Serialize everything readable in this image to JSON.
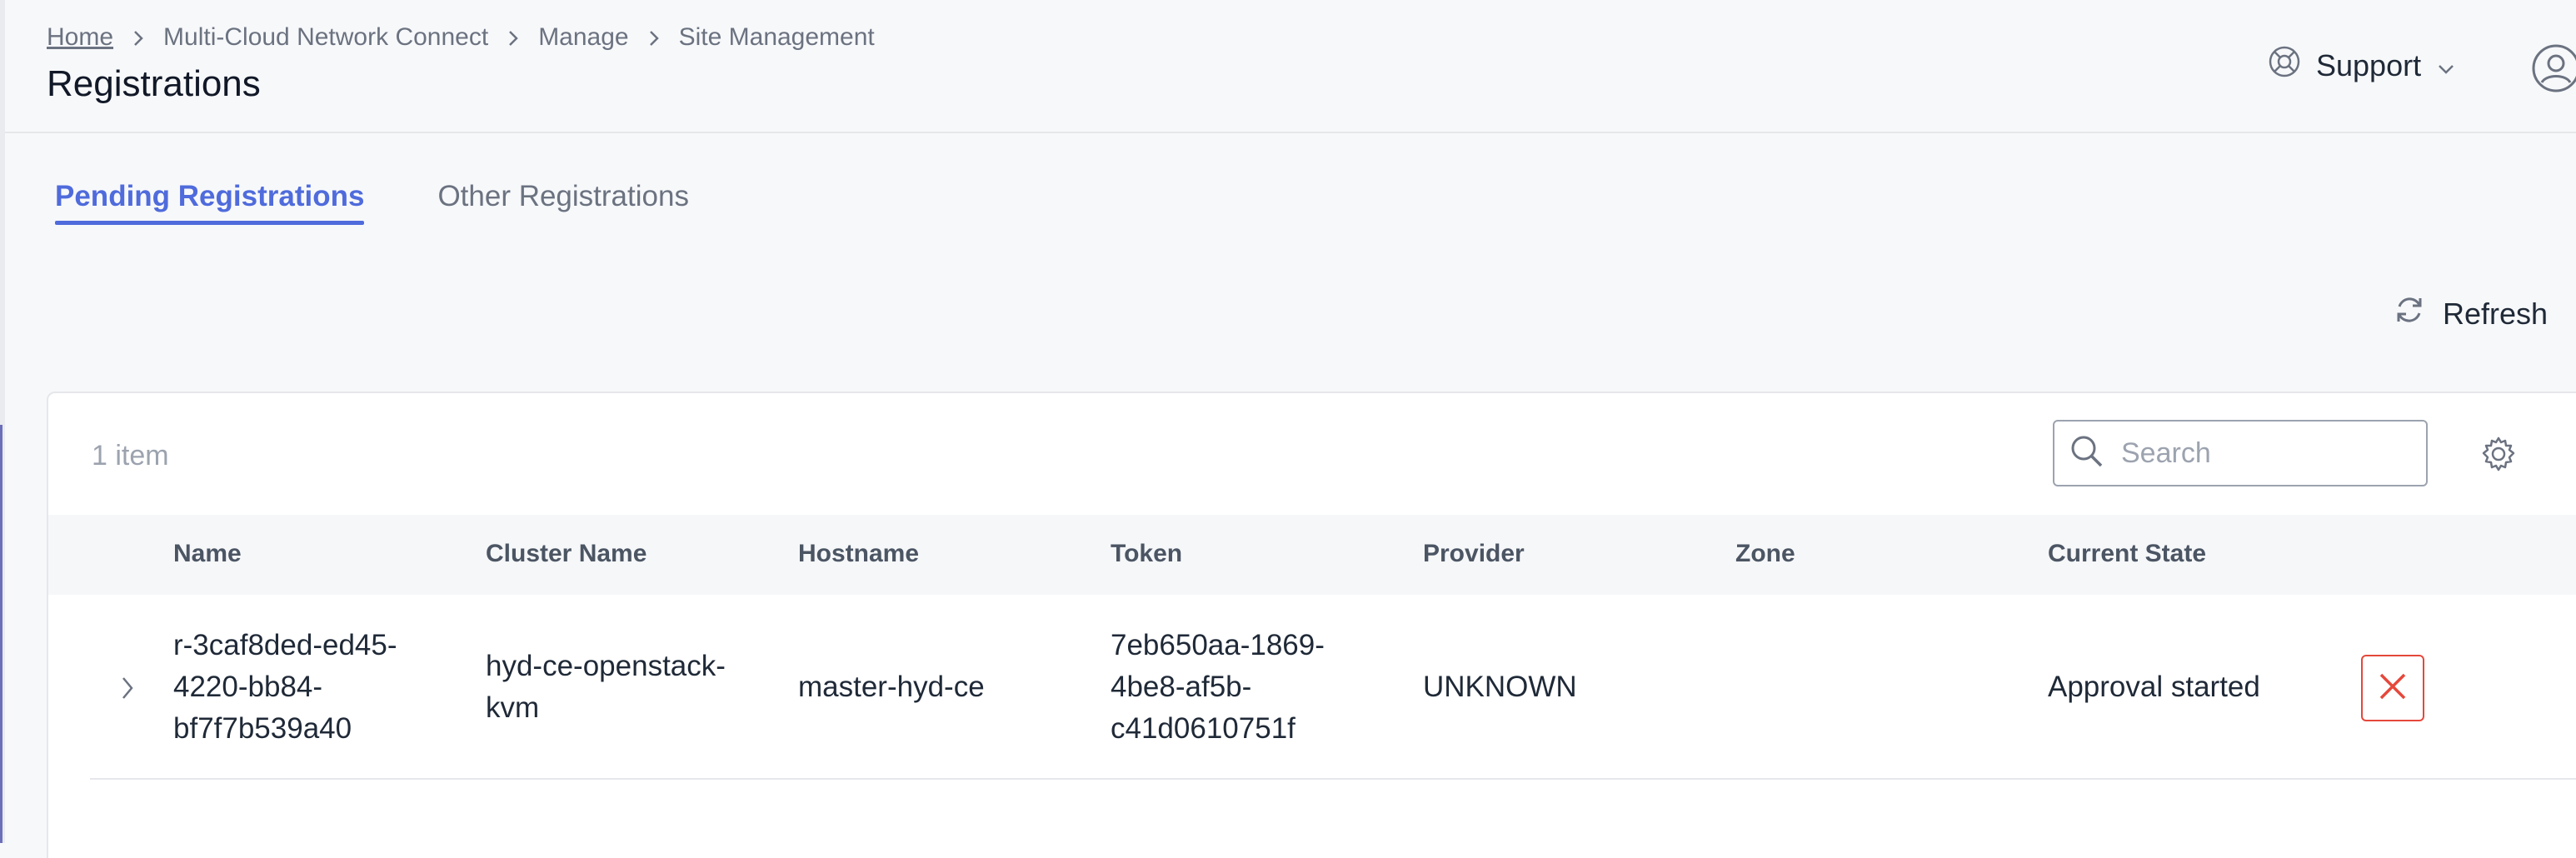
{
  "breadcrumb": [
    "Home",
    "Multi-Cloud Network Connect",
    "Manage",
    "Site Management"
  ],
  "page_title": "Registrations",
  "support_label": "Support",
  "tabs": [
    {
      "label": "Pending Registrations",
      "active": true
    },
    {
      "label": "Other Registrations",
      "active": false
    }
  ],
  "refresh_label": "Refresh",
  "table": {
    "item_count": "1 item",
    "search_placeholder": "Search",
    "columns": [
      "Name",
      "Cluster Name",
      "Hostname",
      "Token",
      "Provider",
      "Zone",
      "Current State"
    ],
    "rows": [
      {
        "name": [
          "r-3caf8ded-ed45-",
          "4220-bb84-",
          "bf7f7b539a40"
        ],
        "cluster_name": [
          "hyd-ce-openstack-",
          "kvm"
        ],
        "hostname": "master-hyd-ce",
        "token": [
          "7eb650aa-1869-",
          "4be8-af5b-",
          "c41d0610751f"
        ],
        "provider": "UNKNOWN",
        "zone": "",
        "current_state": "Approval started"
      }
    ]
  },
  "icons": {
    "support": "lifebuoy-icon",
    "avatar": "user-circle-icon",
    "refresh": "refresh-icon",
    "search": "search-icon",
    "settings": "gear-icon",
    "expand": "chevron-right-icon",
    "delete": "close-icon"
  },
  "colors": {
    "accent": "#4f6bdc",
    "danger": "#e5483b",
    "background": "#f7f8fa"
  }
}
